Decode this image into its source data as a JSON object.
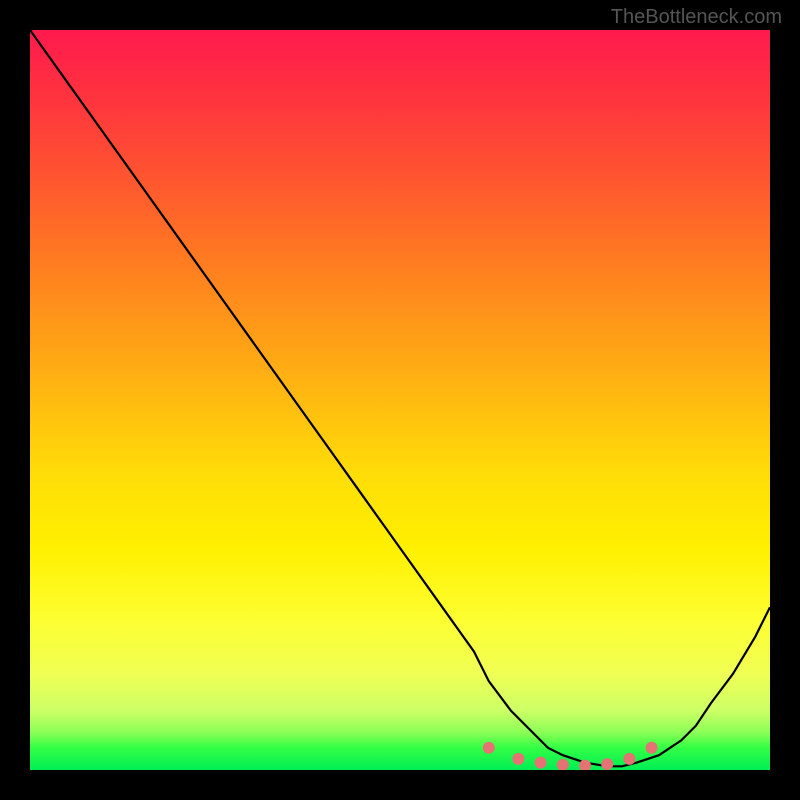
{
  "watermark": "TheBottleneck.com",
  "chart_data": {
    "type": "line",
    "title": "",
    "xlabel": "",
    "ylabel": "",
    "xlim": [
      0,
      100
    ],
    "ylim": [
      0,
      100
    ],
    "series": [
      {
        "name": "bottleneck-curve",
        "x": [
          0,
          5,
          10,
          15,
          20,
          25,
          30,
          35,
          40,
          45,
          50,
          55,
          60,
          62,
          65,
          68,
          70,
          72,
          75,
          78,
          80,
          82,
          85,
          88,
          90,
          92,
          95,
          98,
          100
        ],
        "y": [
          100,
          93,
          86,
          79,
          72,
          65,
          58,
          51,
          44,
          37,
          30,
          23,
          16,
          12,
          8,
          5,
          3,
          2,
          1,
          0.5,
          0.5,
          1,
          2,
          4,
          6,
          9,
          13,
          18,
          22
        ]
      }
    ],
    "markers": {
      "name": "highlight-dots",
      "color": "#e57373",
      "points": [
        {
          "x": 62,
          "y": 3
        },
        {
          "x": 66,
          "y": 1.5
        },
        {
          "x": 69,
          "y": 1
        },
        {
          "x": 72,
          "y": 0.7
        },
        {
          "x": 75,
          "y": 0.6
        },
        {
          "x": 78,
          "y": 0.8
        },
        {
          "x": 81,
          "y": 1.5
        },
        {
          "x": 84,
          "y": 3
        }
      ]
    },
    "gradient_colors": {
      "top": "#ff1a4d",
      "mid_upper": "#ff7722",
      "mid": "#ffdd08",
      "mid_lower": "#fdff33",
      "bottom": "#00ee55"
    }
  }
}
